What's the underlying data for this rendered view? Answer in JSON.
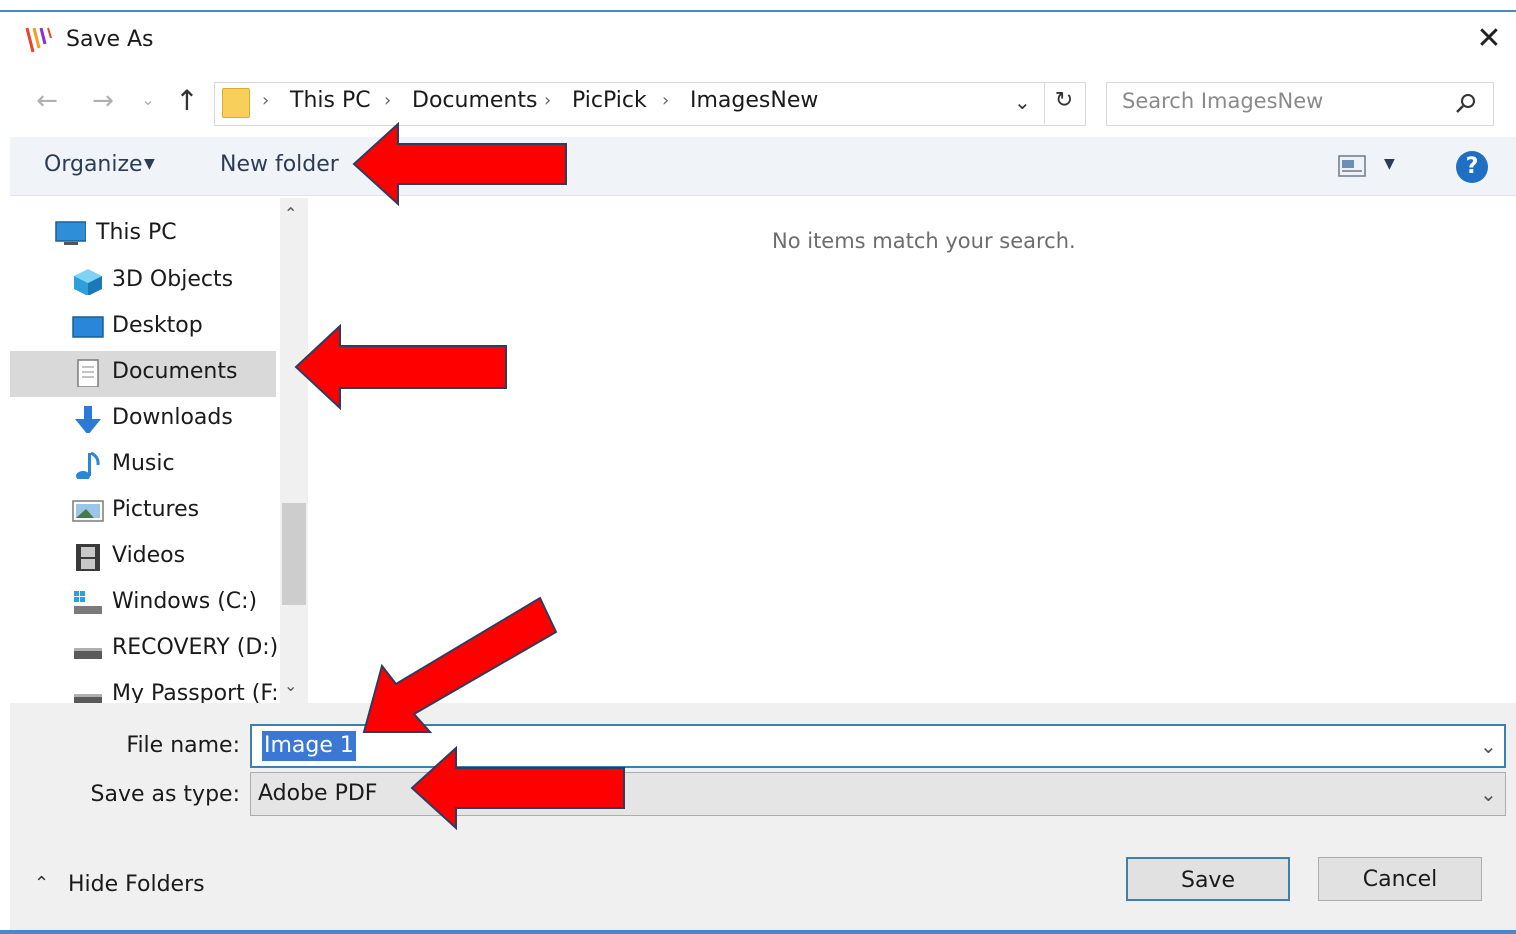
{
  "window": {
    "title": "Save As",
    "close_icon": "close-icon",
    "app_icon": "picpick-logo-icon"
  },
  "nav": {
    "back_icon": "back-arrow-icon",
    "forward_icon": "forward-arrow-icon",
    "recent_icon": "chevron-down-icon",
    "up_icon": "up-arrow-icon",
    "breadcrumb": [
      "This PC",
      "Documents",
      "PicPick",
      "ImagesNew"
    ],
    "refresh_icon": "refresh-icon",
    "search_placeholder": "Search ImagesNew",
    "search_icon": "search-icon"
  },
  "toolbar": {
    "organize_label": "Organize",
    "new_folder_label": "New folder",
    "view_icon": "view-options-icon",
    "help_icon": "help-icon"
  },
  "sidebar": {
    "items": [
      {
        "label": "This PC",
        "icon": "computer-icon"
      },
      {
        "label": "3D Objects",
        "icon": "cube-icon"
      },
      {
        "label": "Desktop",
        "icon": "desktop-icon"
      },
      {
        "label": "Documents",
        "icon": "document-icon",
        "selected": true
      },
      {
        "label": "Downloads",
        "icon": "download-icon"
      },
      {
        "label": "Music",
        "icon": "music-note-icon"
      },
      {
        "label": "Pictures",
        "icon": "picture-icon"
      },
      {
        "label": "Videos",
        "icon": "film-icon"
      },
      {
        "label": "Windows (C:)",
        "icon": "drive-icon"
      },
      {
        "label": "RECOVERY (D:)",
        "icon": "drive-icon"
      },
      {
        "label": "My Passport (F:)",
        "icon": "drive-icon"
      }
    ]
  },
  "content": {
    "empty_message": "No items match your search."
  },
  "form": {
    "file_name_label": "File name:",
    "file_name_value": "Image 1",
    "save_type_label": "Save as type:",
    "save_type_value": "Adobe PDF"
  },
  "footer": {
    "hide_folders_label": "Hide Folders",
    "save_label": "Save",
    "cancel_label": "Cancel"
  },
  "colors": {
    "accent": "#3c7fb1",
    "annotation_arrow": "#ff0000"
  }
}
